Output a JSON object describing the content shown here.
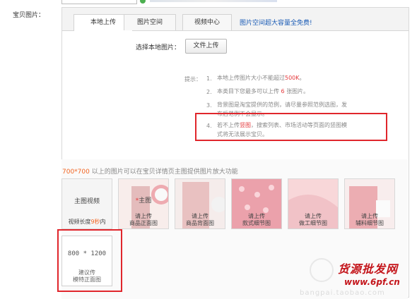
{
  "field_label": "宝贝图片：",
  "tabs": [
    {
      "label": "本地上传",
      "active": true
    },
    {
      "label": "图片空间",
      "active": false
    },
    {
      "label": "视频中心",
      "active": false
    }
  ],
  "tab_promo_link": "图片空间超大容量全免费!",
  "upload": {
    "choose_label": "选择本地图片：",
    "button_label": "文件上传"
  },
  "tips": {
    "label": "提示：",
    "items": [
      {
        "num": "1.",
        "pre": "本地上传图片大小不能超过",
        "hl": "500K",
        "post": "。"
      },
      {
        "num": "2.",
        "pre": "本类目下您最多可以上传",
        "hl": "6",
        "post": "张图片。"
      },
      {
        "num": "3.",
        "line1": "背景图是淘宝提供的范例，请尽量参照范例选图，发",
        "line2": "布后范例不会显示。"
      },
      {
        "num": "4.",
        "pre": "若不上传",
        "hl": "竖图",
        "post": "，搜索列表、市场活动等页面的竖图模",
        "line2": "式将无法展示宝贝。"
      }
    ]
  },
  "dimension_note": {
    "size": "700*700",
    "text": "以上的图片可以在宝贝详情页主图提供图片放大功能"
  },
  "thumbnails": [
    {
      "line1": "主图视频",
      "line2_pre": "视频长度",
      "line2_hl": "9秒",
      "line2_post": "内",
      "bg": "#f4f4f4"
    },
    {
      "line1_star": "*",
      "line1": "主图",
      "line2": "请上传",
      "line3": "商品正面图",
      "bg": "#e9c9c4"
    },
    {
      "line2": "请上传",
      "line3": "商品背面图",
      "bg": "#d7a9a9"
    },
    {
      "line2": "请上传",
      "line3": "款式细节图",
      "bg": "#d8354a"
    },
    {
      "line2": "请上传",
      "line3": "做工细节图",
      "bg": "#ec8c92"
    },
    {
      "line2": "请上传",
      "line3": "辅料细节图",
      "bg": "#d14a54"
    }
  ],
  "model_slot": {
    "size": "800 * 1200",
    "line1": "建议传",
    "line2": "模特正面图"
  },
  "watermark": {
    "title": "货源批发网",
    "url": "www.6pf.cn",
    "faint": "bangpai.taobao.com"
  },
  "colors": {
    "accent_red": "#e0262c",
    "link_blue": "#1a5bb5",
    "highlight_orange": "#f26522"
  }
}
